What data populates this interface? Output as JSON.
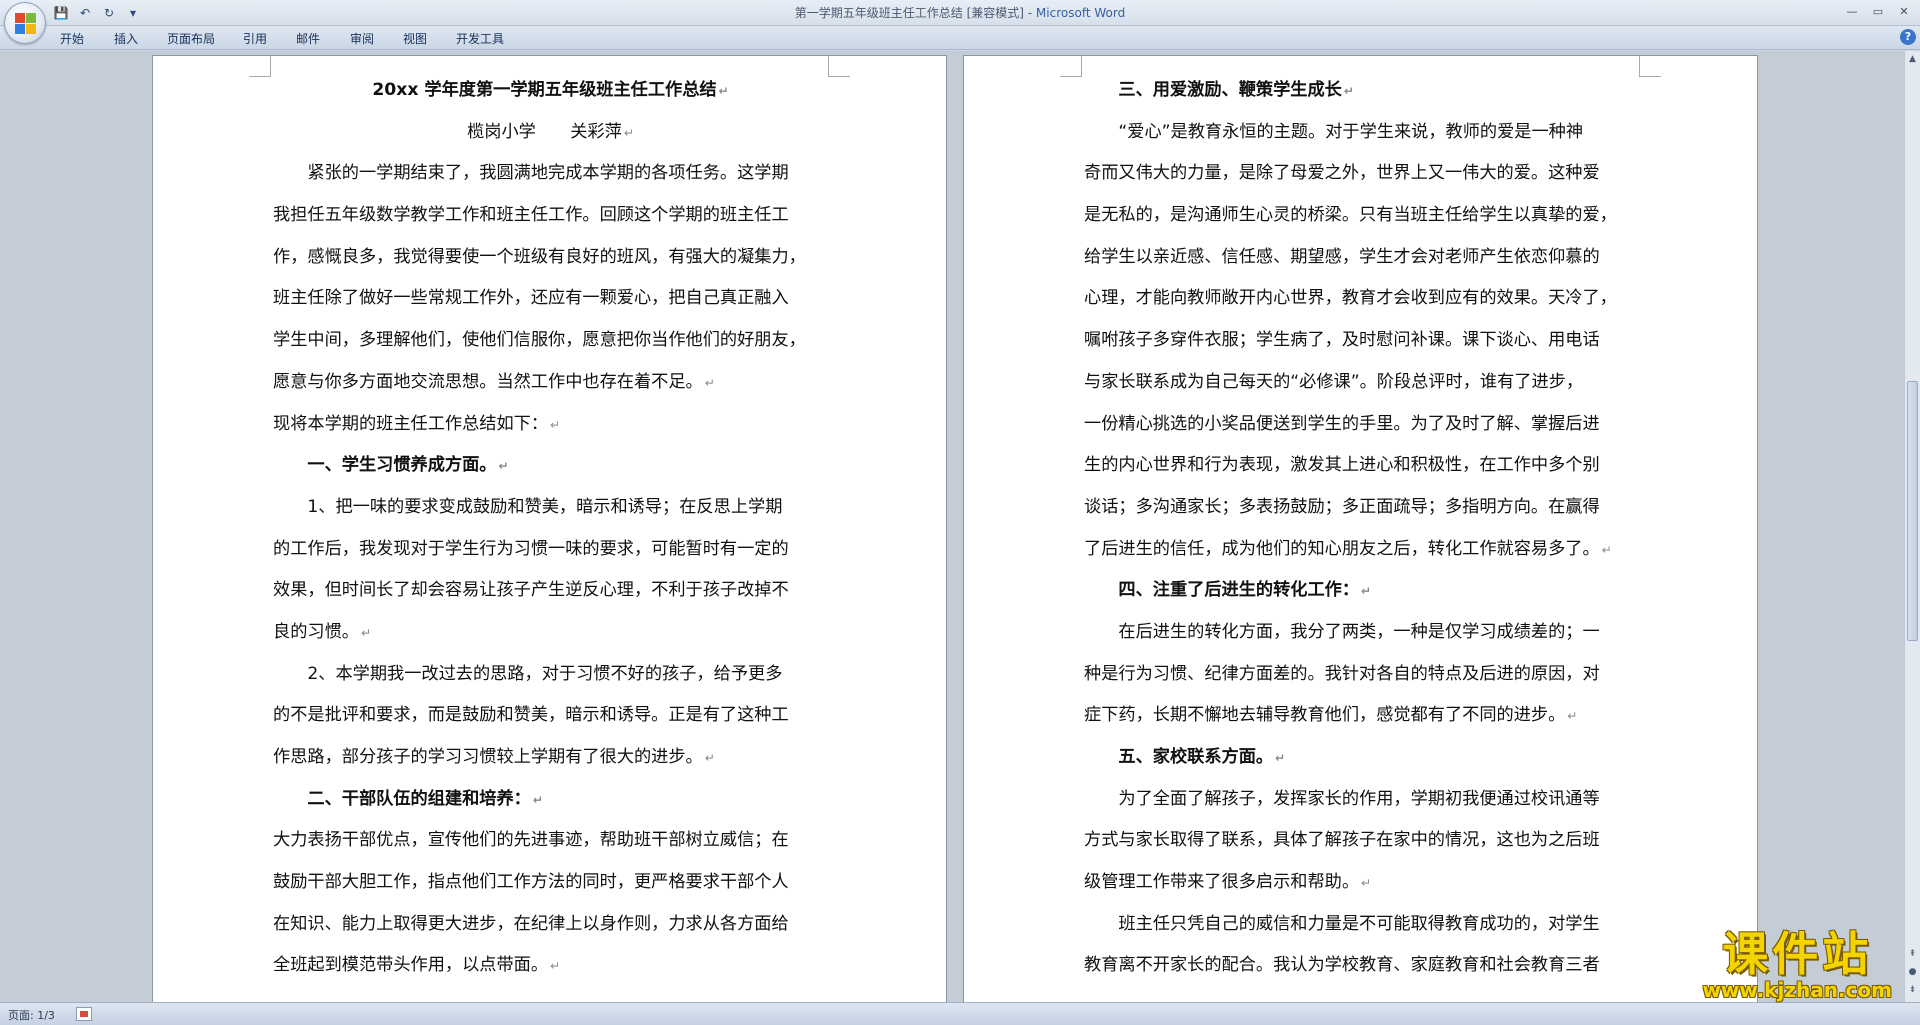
{
  "window": {
    "title_doc": "第一学期五年级班主任工作总结 [兼容模式] - ",
    "title_app": "Microsoft Word",
    "minimize": "—",
    "maximize": "▭",
    "close": "✕"
  },
  "qat": {
    "save_icon": "save-icon",
    "undo_icon": "undo-icon",
    "redo_icon": "redo-icon",
    "customize_icon": "dropdown-icon"
  },
  "ribbon": {
    "tabs": [
      "开始",
      "插入",
      "页面布局",
      "引用",
      "邮件",
      "审阅",
      "视图",
      "开发工具"
    ],
    "help": "?"
  },
  "page_left": {
    "lines": [
      "20xx 学年度第一学期五年级班主任工作总结",
      "榄岗小学　　关彩萍",
      "　　紧张的一学期结束了，我圆满地完成本学期的各项任务。这学期",
      "我担任五年级数学教学工作和班主任工作。回顾这个学期的班主任工",
      "作，感慨良多，我觉得要使一个班级有良好的班风，有强大的凝集力，",
      "班主任除了做好一些常规工作外，还应有一颗爱心，把自己真正融入",
      "学生中间，多理解他们，使他们信服你，愿意把你当作他们的好朋友，",
      "愿意与你多方面地交流思想。当然工作中也存在着不足。",
      "现将本学期的班主任工作总结如下：",
      "　　一、学生习惯养成方面。",
      "　　1、把一味的要求变成鼓励和赞美，暗示和诱导；在反思上学期",
      "的工作后，我发现对于学生行为习惯一味的要求，可能暂时有一定的",
      "效果，但时间长了却会容易让孩子产生逆反心理，不利于孩子改掉不",
      "良的习惯。",
      "　　2、本学期我一改过去的思路，对于习惯不好的孩子，给予更多",
      "的不是批评和要求，而是鼓励和赞美，暗示和诱导。正是有了这种工",
      "作思路，部分孩子的学习习惯较上学期有了很大的进步。",
      "　　二、干部队伍的组建和培养：",
      "大力表扬干部优点，宣传他们的先进事迹，帮助班干部树立威信；在",
      "鼓励干部大胆工作，指点他们工作方法的同时，更严格要求干部个人",
      "在知识、能力上取得更大进步，在纪律上以身作则，力求从各方面给",
      "全班起到模范带头作用，以点带面。"
    ]
  },
  "page_right": {
    "lines": [
      "　　三、用爱激励、鞭策学生成长",
      "　　“爱心”是教育永恒的主题。对于学生来说，教师的爱是一种神",
      "奇而又伟大的力量，是除了母爱之外，世界上又一伟大的爱。这种爱",
      "是无私的，是沟通师生心灵的桥梁。只有当班主任给学生以真挚的爱，",
      "给学生以亲近感、信任感、期望感，学生才会对老师产生依恋仰慕的",
      "心理，才能向教师敞开内心世界，教育才会收到应有的效果。天冷了，",
      "嘱咐孩子多穿件衣服；学生病了，及时慰问补课。课下谈心、用电话",
      "与家长联系成为自己每天的“必修课”。阶段总评时，谁有了进步，",
      "一份精心挑选的小奖品便送到学生的手里。为了及时了解、掌握后进",
      "生的内心世界和行为表现，激发其上进心和积极性，在工作中多个别",
      "谈话；多沟通家长；多表扬鼓励；多正面疏导；多指明方向。在赢得",
      "了后进生的信任，成为他们的知心朋友之后，转化工作就容易多了。",
      "　　四、注重了后进生的转化工作：",
      "　　在后进生的转化方面，我分了两类，一种是仅学习成绩差的；一",
      "种是行为习惯、纪律方面差的。我针对各自的特点及后进的原因，对",
      "症下药，长期不懈地去辅导教育他们，感觉都有了不同的进步。",
      "　　五、家校联系方面。",
      "　　为了全面了解孩子，发挥家长的作用，学期初我便通过校讯通等",
      "方式与家长取得了联系，具体了解孩子在家中的情况，这也为之后班",
      "级管理工作带来了很多启示和帮助。",
      "　　班主任只凭自己的威信和力量是不可能取得教育成功的，对学生",
      "教育离不开家长的配合。我认为学校教育、家庭教育和社会教育三者"
    ]
  },
  "status": {
    "page_label": "页面: 1/3"
  },
  "watermark": {
    "title": "课件站",
    "url": "www.kjzhan.com"
  }
}
